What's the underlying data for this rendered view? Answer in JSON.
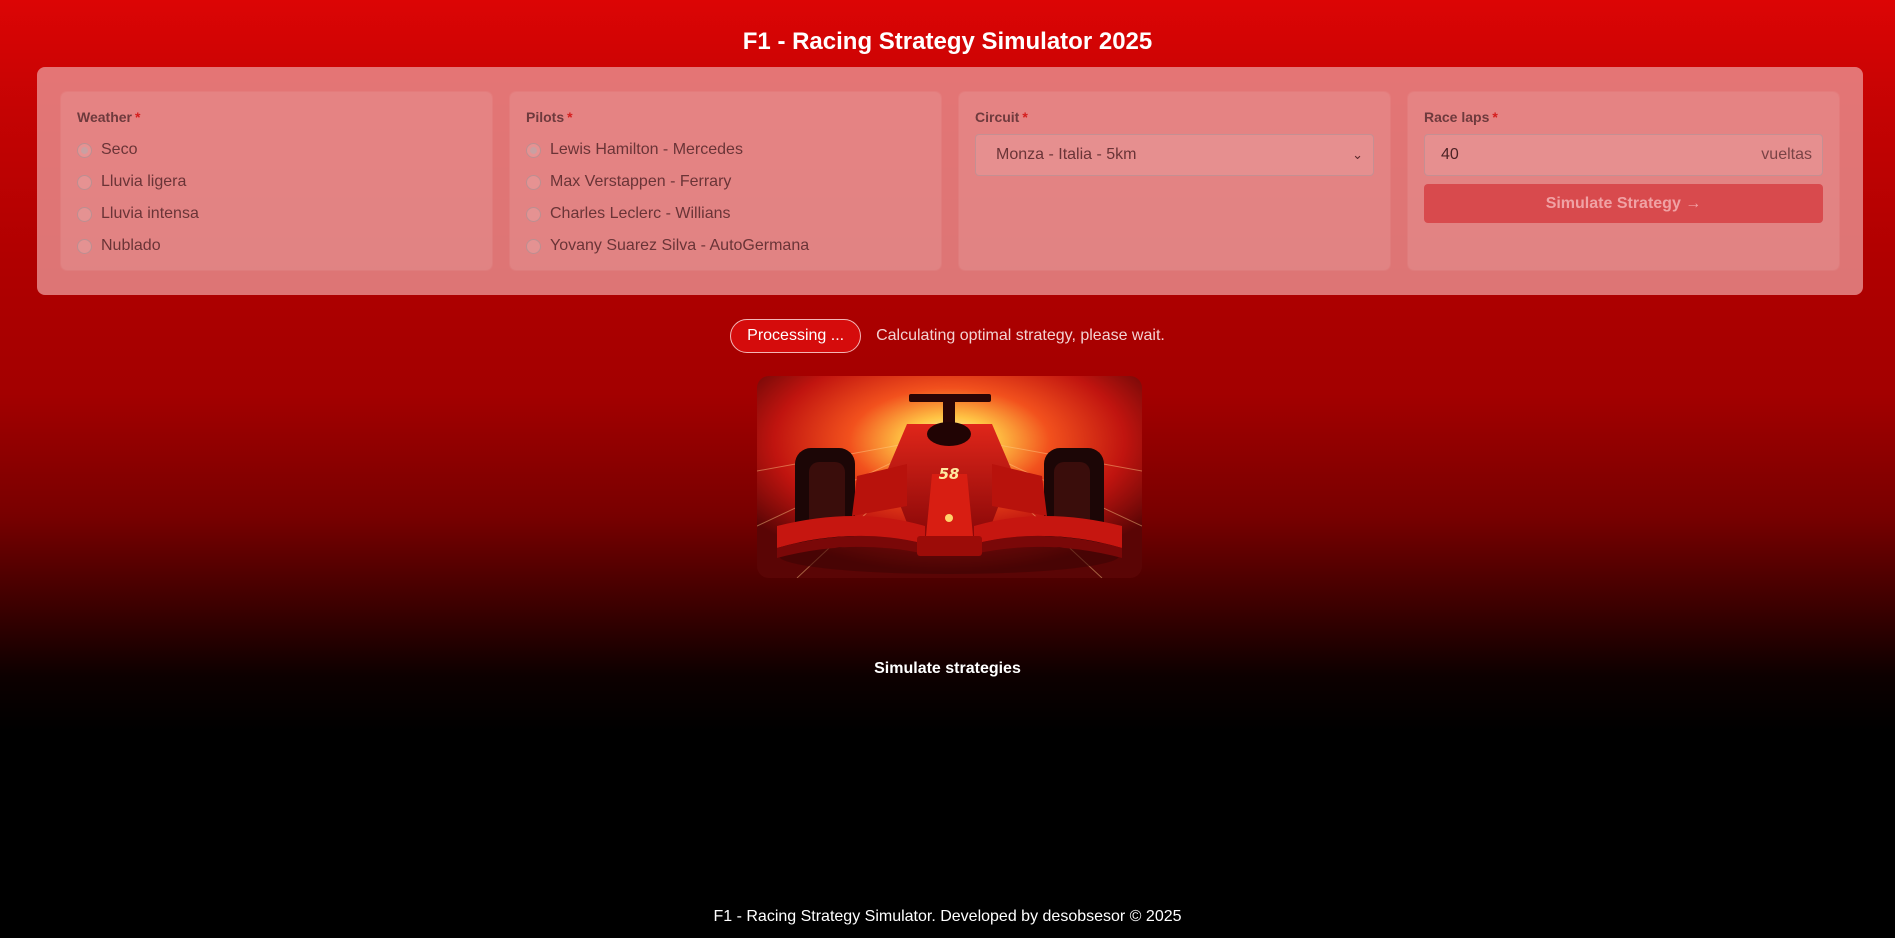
{
  "header": {
    "title": "F1 - Racing Strategy Simulator 2025"
  },
  "form": {
    "weather": {
      "label": "Weather",
      "required_mark": "*",
      "options": [
        "Seco",
        "Lluvia ligera",
        "Lluvia intensa",
        "Nublado"
      ],
      "selected": "Seco"
    },
    "pilots": {
      "label": "Pilots",
      "required_mark": "*",
      "options": [
        "Lewis Hamilton - Mercedes",
        "Max Verstappen - Ferrary",
        "Charles Leclerc - Willians",
        "Yovany Suarez Silva - AutoGermana"
      ],
      "selected": "Lewis Hamilton - Mercedes"
    },
    "circuit": {
      "label": "Circuit",
      "required_mark": "*",
      "selected": "Monza - Italia - 5km"
    },
    "laps": {
      "label": "Race laps",
      "required_mark": "*",
      "value": "40",
      "unit": "vueltas"
    },
    "submit_label": "Simulate Strategy →"
  },
  "status": {
    "badge": "Processing ...",
    "message": "Calculating optimal strategy, please wait."
  },
  "image": {
    "number": "58"
  },
  "section": {
    "title": "Simulate strategies"
  },
  "footer": {
    "text": "F1 - Racing Strategy Simulator. Developed by desobsesor © 2025"
  },
  "colors": {
    "accent": "#d50c0c",
    "panel": "#ea9696",
    "button": "#d84a4d"
  }
}
